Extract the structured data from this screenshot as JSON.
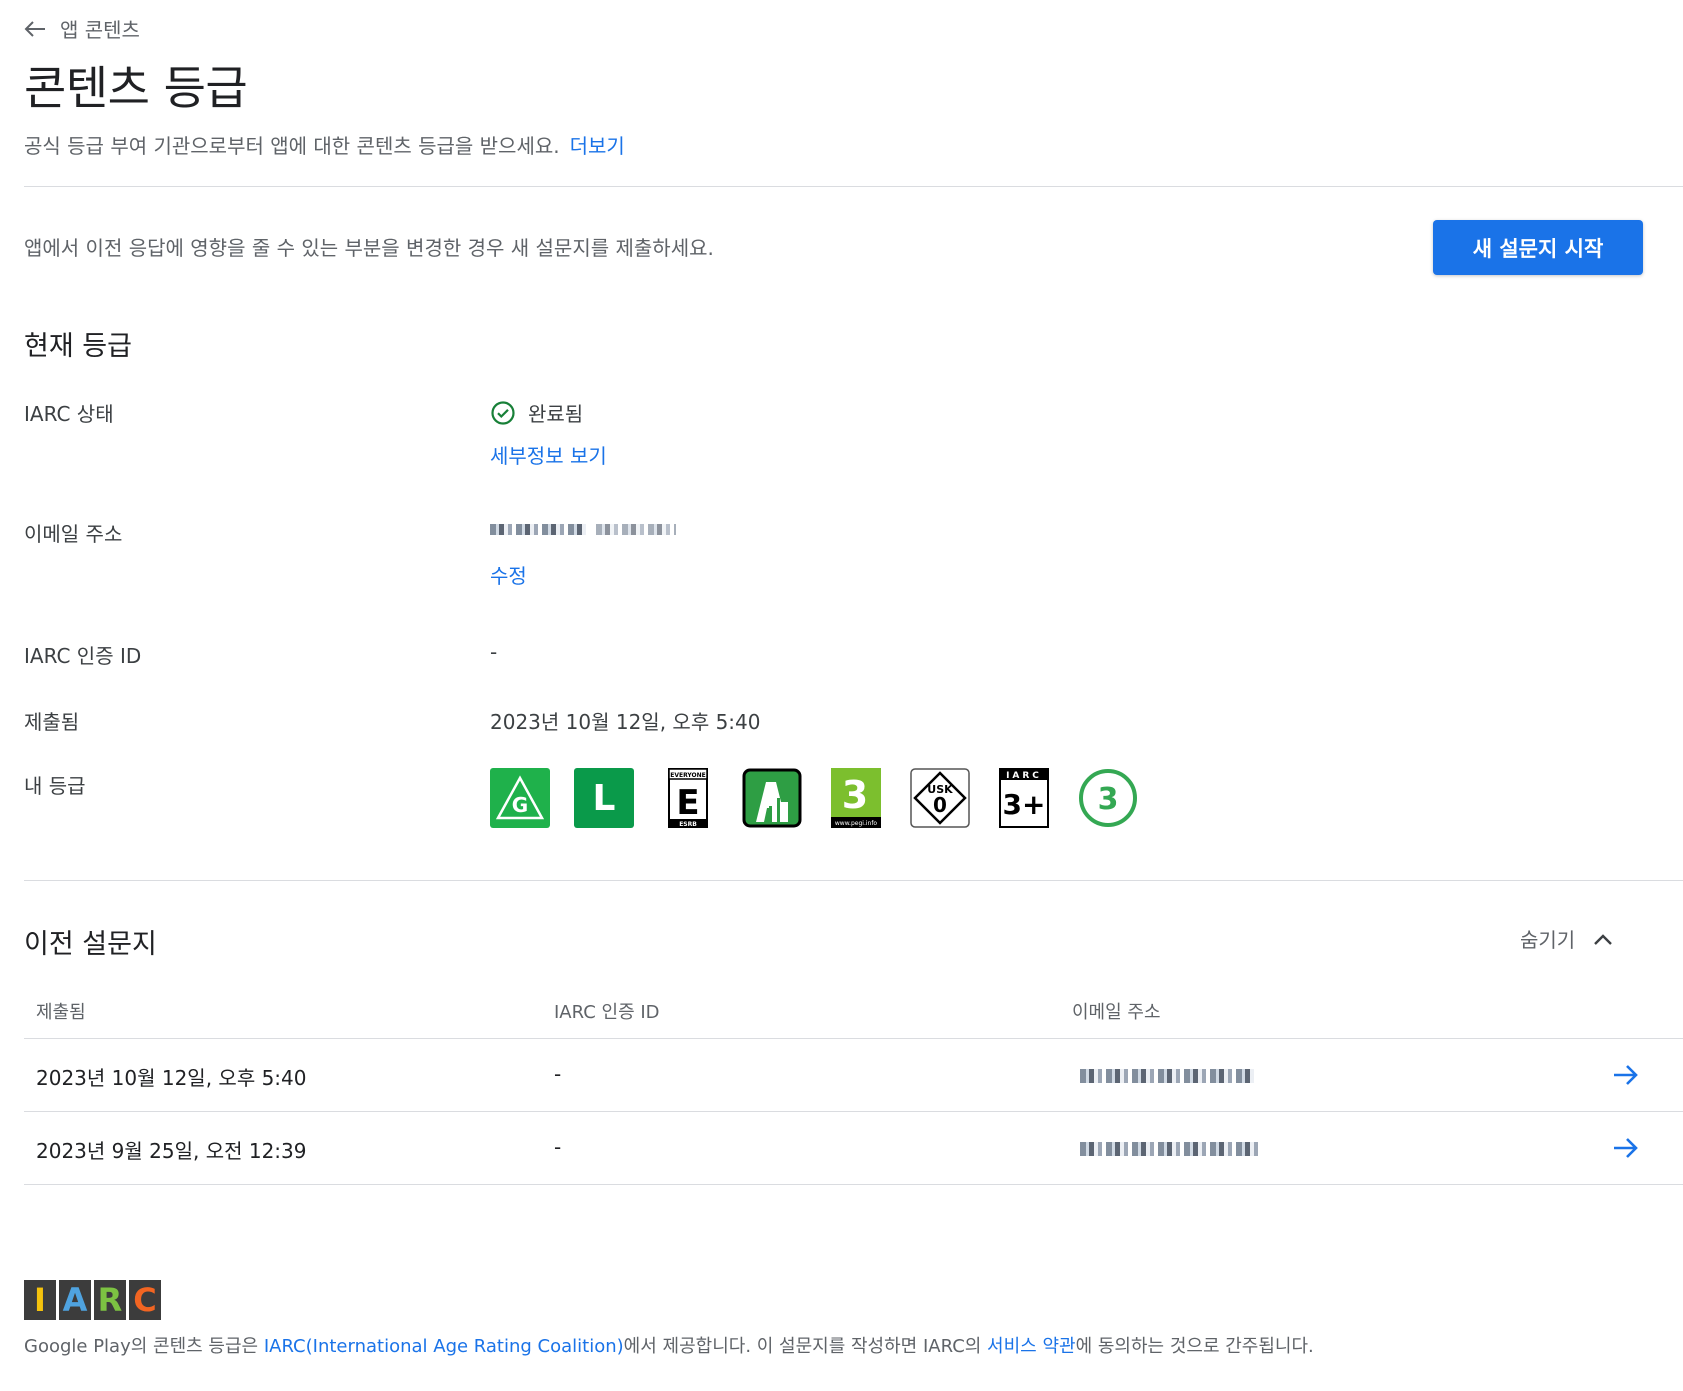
{
  "header": {
    "back_label": "앱 콘텐츠",
    "title": "콘텐츠 등급",
    "subtitle": "공식 등급 부여 기관으로부터 앱에 대한 콘텐츠 등급을 받으세요.",
    "learn_more": "더보기"
  },
  "notice": {
    "text": "앱에서 이전 응답에 영향을 줄 수 있는 부분을 변경한 경우 새 설문지를 제출하세요.",
    "button": "새 설문지 시작"
  },
  "current": {
    "section_title": "현재 등급",
    "iarc_status_label": "IARC 상태",
    "iarc_status_value": "완료됨",
    "details_link": "세부정보 보기",
    "email_label": "이메일 주소",
    "email_edit": "수정",
    "cert_label": "IARC 인증 ID",
    "cert_value": "-",
    "submitted_label": "제출됨",
    "submitted_value": "2023년 10월 12일, 오후 5:40",
    "my_rating_label": "내 등급",
    "ratings": [
      {
        "icon": "classind-g-icon",
        "text": "G"
      },
      {
        "icon": "classind-l-icon",
        "text": "L"
      },
      {
        "icon": "esrb-everyone-icon",
        "text": "E",
        "top": "EVERYONE",
        "bottom": "ESRB"
      },
      {
        "icon": "acb-general-icon",
        "text": ""
      },
      {
        "icon": "pegi-3-icon",
        "text": "3",
        "bottom": "www.pegi.info"
      },
      {
        "icon": "usk-0-icon",
        "text": "0",
        "top": "USK"
      },
      {
        "icon": "iarc-3plus-icon",
        "text": "3+",
        "top": "IARC"
      },
      {
        "icon": "generic-3-icon",
        "text": "3"
      }
    ]
  },
  "previous": {
    "section_title": "이전 설문지",
    "hide_label": "숨기기",
    "columns": [
      "제출됨",
      "IARC 인증 ID",
      "이메일 주소"
    ],
    "rows": [
      {
        "submitted": "2023년 10월 12일, 오후 5:40",
        "cert_id": "-"
      },
      {
        "submitted": "2023년 9월 25일, 오전 12:39",
        "cert_id": "-"
      }
    ]
  },
  "footer": {
    "logo_letters": [
      "I",
      "A",
      "R",
      "C"
    ],
    "logo_colors": [
      "#f4c20d",
      "#4fa3e0",
      "#7cc242",
      "#f26522"
    ],
    "text_1": "Google Play의 콘텐츠 등급은 ",
    "iarc_link": "IARC(International Age Rating Coalition)",
    "text_2": "에서 제공합니다. 이 설문지를 작성하면 IARC의 ",
    "terms_link": "서비스 약관",
    "text_3": "에 동의하는 것으로 간주됩니다."
  },
  "colors": {
    "accent": "#1a73e8",
    "success": "#188038",
    "text_secondary": "#5f6368"
  }
}
